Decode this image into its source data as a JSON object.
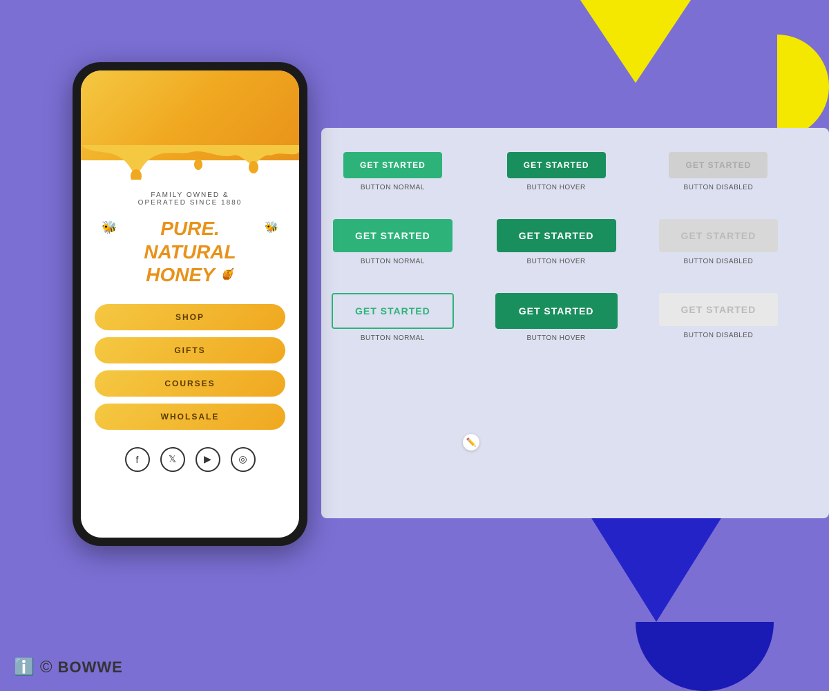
{
  "background": {
    "color": "#7b6fd4"
  },
  "phone": {
    "subtitle": "FAMILY OWNED &\nOPERATED SINCE 1880",
    "title_line1": "PURE.",
    "title_line2": "NATURAL",
    "title_line3": "HONEY",
    "nav_items": [
      "SHOP",
      "GIFTS",
      "COURSES",
      "WHOLSALE"
    ],
    "social_icons": [
      "f",
      "t",
      "▶",
      "📷"
    ]
  },
  "buttons": {
    "row1": {
      "normal": "GET STARTED",
      "hover": "GET STARTED",
      "disabled": "GET STARTED",
      "label_normal": "BUTTON NORMAL",
      "label_hover": "BUTTON HOVER",
      "label_disabled": "BUTTON DISABLED"
    },
    "row2": {
      "normal": "GET STARTED",
      "hover": "GET STARTED",
      "disabled": "GET STARTED",
      "label_normal": "BUTTON NORMAL",
      "label_hover": "BUTTON HOVER",
      "label_disabled": "BUTTON DISABLED"
    },
    "row3": {
      "normal": "GET STARTED",
      "hover": "GET STARTED",
      "disabled": "GET STARTED",
      "label_normal": "BUTTON NORMAL",
      "label_hover": "BUTTON HOVER",
      "label_disabled": "BUTTON DISABLED"
    }
  },
  "footer": {
    "logo": "BOWWE"
  }
}
